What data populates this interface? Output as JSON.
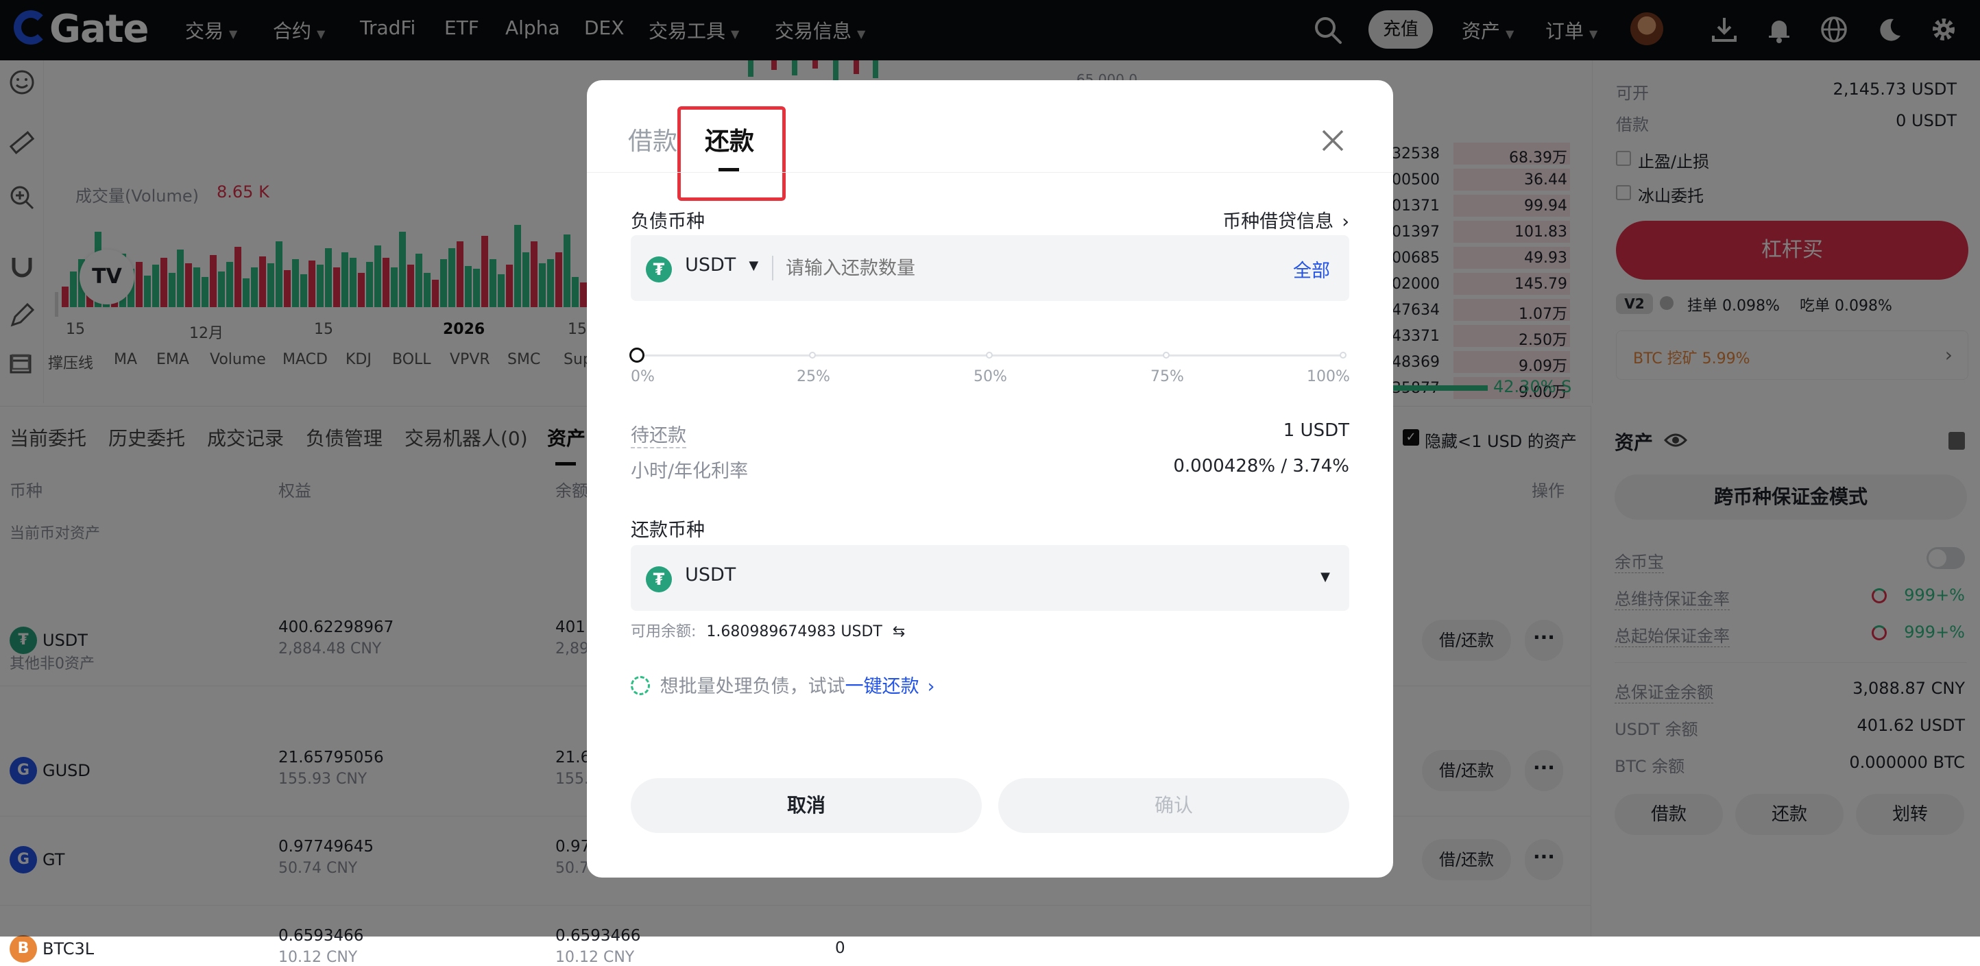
{
  "nav": {
    "logo": "Gate",
    "items": [
      "交易",
      "合约",
      "TradFi",
      "ETF",
      "Alpha",
      "DEX",
      "交易工具",
      "交易信息"
    ],
    "deposit": "充值",
    "assets": "资产",
    "orders": "订单"
  },
  "chart": {
    "volume_label": "成交量(Volume)",
    "volume_value": "8.65 K",
    "price_tag": "65,000.0",
    "xaxis": [
      "15",
      "12月",
      "15",
      "2026",
      "15"
    ],
    "indicators": [
      "撑压线",
      "MA",
      "EMA",
      "Volume",
      "MACD",
      "KDJ",
      "BOLL",
      "VPVR",
      "SMC",
      "Sup"
    ]
  },
  "orderbook": {
    "rows": [
      {
        "price": "32538",
        "amount": "68.39万"
      },
      {
        "price": "00500",
        "amount": "36.44"
      },
      {
        "price": "01371",
        "amount": "99.94"
      },
      {
        "price": "01397",
        "amount": "101.83"
      },
      {
        "price": "00685",
        "amount": "49.93"
      },
      {
        "price": "02000",
        "amount": "145.79"
      },
      {
        "price": "47634",
        "amount": "1.07万"
      },
      {
        "price": "43371",
        "amount": "2.50万"
      },
      {
        "price": "48369",
        "amount": "9.09万"
      },
      {
        "price": "35877",
        "amount": "9.00万"
      }
    ],
    "ratio": "42.30% S"
  },
  "trade_panel": {
    "available_label": "可开",
    "available_value": "2,145.73 USDT",
    "borrow_label": "借款",
    "borrow_value": "0 USDT",
    "tp_sl": "止盈/止损",
    "iceberg": "冰山委托",
    "buy_button": "杠杆买",
    "vip": "V2",
    "maker": "挂单 0.098%",
    "taker": "吃单 0.098%",
    "mining": "BTC 挖矿 5.99%"
  },
  "bottom_tabs": [
    "当前委托",
    "历史委托",
    "成交记录",
    "负债管理",
    "交易机器人(0)",
    "资产"
  ],
  "hide_small": "隐藏<1 USD 的资产",
  "assets_table": {
    "headers": {
      "coin": "币种",
      "equity": "权益",
      "balance": "余额",
      "ops": "操作"
    },
    "section1": "当前币对资产",
    "section2": "其他非0资产",
    "rows": [
      {
        "coin": "USDT",
        "equity": "400.62298967",
        "equity_cny": "2,884.48 CNY",
        "balance": "401.",
        "balance_cny": "2,89",
        "extra": ""
      },
      {
        "coin": "GUSD",
        "equity": "21.65795056",
        "equity_cny": "155.93 CNY",
        "balance": "21.6",
        "balance_cny": "155.",
        "extra": ""
      },
      {
        "coin": "GT",
        "equity": "0.97749645",
        "equity_cny": "50.74 CNY",
        "balance": "0.97",
        "balance_cny": "50.7",
        "extra": ""
      },
      {
        "coin": "BTC3L",
        "equity": "0.6593466",
        "equity_cny": "10.12 CNY",
        "balance": "0.6593466",
        "balance_cny": "10.12 CNY",
        "extra": "0"
      }
    ],
    "borrow_repay": "借/还款"
  },
  "assets_panel": {
    "title": "资产",
    "mode": "跨币种保证金模式",
    "yubibao": "余币宝",
    "maint_rate_label": "总维持保证金率",
    "maint_rate_value": "999+%",
    "init_rate_label": "总起始保证金率",
    "init_rate_value": "999+%",
    "total_margin_label": "总保证金余额",
    "total_margin_value": "3,088.87 CNY",
    "usdt_bal_label": "USDT 余额",
    "usdt_bal_value": "401.62 USDT",
    "btc_bal_label": "BTC 余额",
    "btc_bal_value": "0.000000 BTC",
    "btn_borrow": "借款",
    "btn_repay": "还款",
    "btn_transfer": "划转"
  },
  "modal": {
    "tab_borrow": "借款",
    "tab_repay": "还款",
    "debt_coin_label": "负债币种",
    "borrow_info_link": "币种借贷信息",
    "debt_coin": "USDT",
    "amount_placeholder": "请输入还款数量",
    "all_button": "全部",
    "slider_progress": 0,
    "slider_ticks": [
      "0%",
      "25%",
      "50%",
      "75%",
      "100%"
    ],
    "pending_label": "待还款",
    "pending_value": "1 USDT",
    "rate_label": "小时/年化利率",
    "rate_value": "0.000428% / 3.74%",
    "repay_coin_label": "还款币种",
    "repay_coin": "USDT",
    "available_label": "可用余额:",
    "available_value": "1.680989674983 USDT",
    "batch_hint": "想批量处理负债，试试",
    "batch_link": "一键还款",
    "cancel": "取消",
    "confirm": "确认"
  },
  "colors": {
    "accent_blue": "#2354e6",
    "green": "#2ebd85",
    "red": "#e0314a",
    "highlight_box": "#e5323c"
  }
}
